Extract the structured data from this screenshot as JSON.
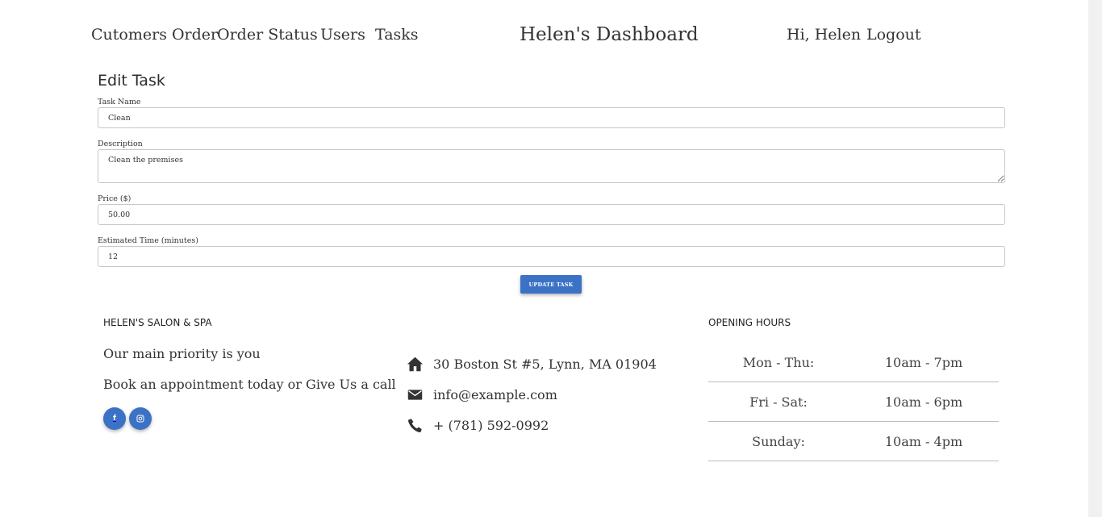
{
  "nav": {
    "links": [
      "Cutomers Order",
      "Order Status",
      "Users",
      "Tasks"
    ],
    "brand": "Helen's Dashboard",
    "greeting": "Hi, Helen",
    "logout": "Logout"
  },
  "form": {
    "title": "Edit Task",
    "task_name_label": "Task Name",
    "task_name_value": "Clean",
    "description_label": "Description",
    "description_value": "Clean the premises",
    "price_label": "Price ($)",
    "price_value": "50.00",
    "time_label": "Estimated Time (minutes)",
    "time_value": "12",
    "submit_label": "Update Task"
  },
  "footer": {
    "about_heading": "Helen's Salon & Spa",
    "tagline": "Our main priority is you",
    "cta": "Book an appointment today or Give Us a call",
    "social": [
      "facebook-icon",
      "instagram-icon"
    ],
    "address": "30 Boston St #5, Lynn, MA 01904",
    "email": "info@example.com",
    "phone": "+ (781) 592-0992",
    "hours_heading": "Opening Hours",
    "hours": [
      {
        "day": "Mon - Thu:",
        "time": "10am - 7pm"
      },
      {
        "day": "Fri - Sat:",
        "time": "10am - 6pm"
      },
      {
        "day": "Sunday:",
        "time": "10am - 4pm"
      }
    ]
  },
  "colors": {
    "accent": "#3b72c6",
    "text": "#333333",
    "border": "#c8c8c8"
  }
}
